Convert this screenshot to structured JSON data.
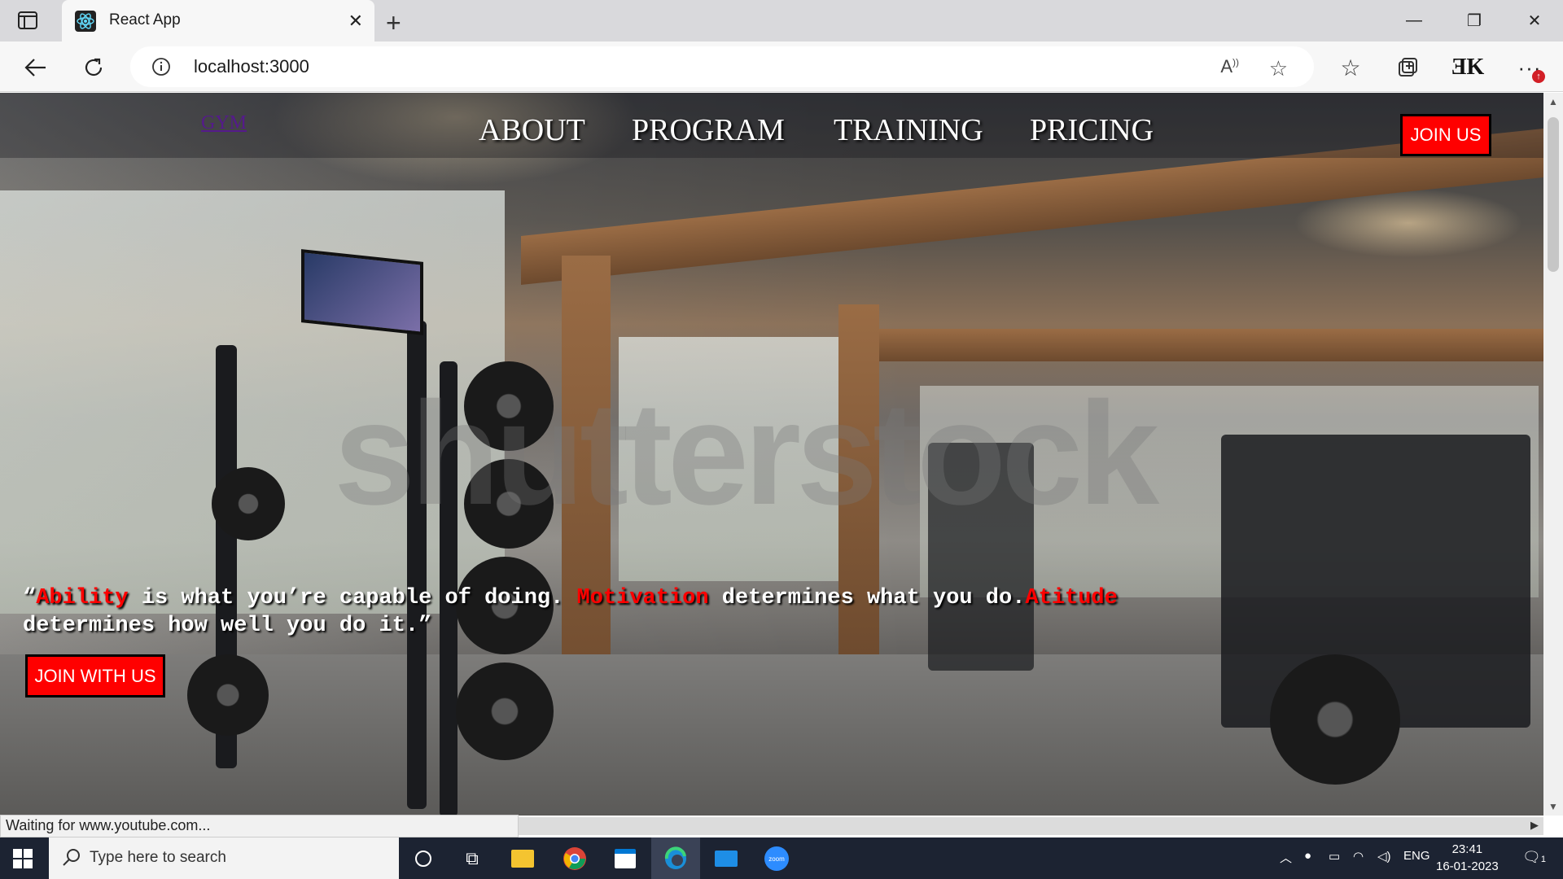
{
  "browser": {
    "tab_title": "React App",
    "address": "localhost:3000",
    "status_text": "Waiting for www.youtube.com..."
  },
  "nav": {
    "logo": "GYM",
    "items": [
      "ABOUT",
      "PROGRAM",
      "TRAINING",
      "PRICING"
    ],
    "join_button": "JOIN US"
  },
  "hero": {
    "watermark": "shutterstock",
    "quote": {
      "open": "“",
      "word1": "Ability",
      "part1": " is what you’re capable of doing. ",
      "word2": "Motivation",
      "part2": " determines what you do.",
      "word3": "Atitude",
      "part3": " determines how well you do it.”"
    },
    "join_button": "JOIN WITH US"
  },
  "taskbar": {
    "search_placeholder": "Type here to search",
    "lang": "ENG",
    "time": "23:41",
    "date": "16-01-2023",
    "notification_count": "1"
  },
  "colors": {
    "accent_red": "#ff0000",
    "link_purple": "#551a8b",
    "taskbar": "#1c2332"
  }
}
